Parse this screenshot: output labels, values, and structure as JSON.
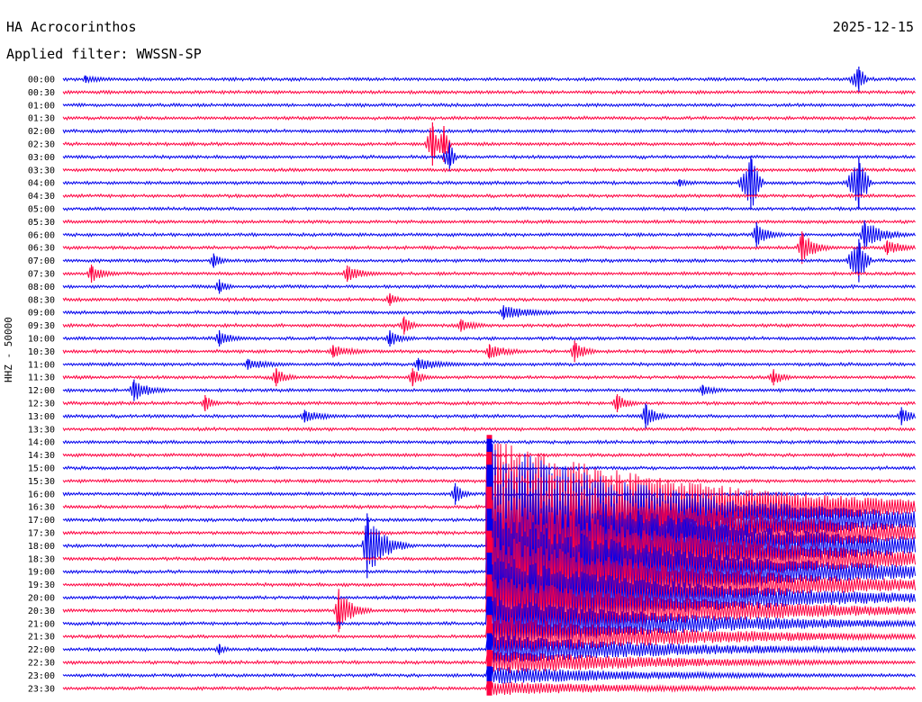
{
  "header": {
    "station": "HA Acrocorinthos",
    "date": "2025-12-15",
    "filter": "Applied filter: WWSSN-SP"
  },
  "axis_label": "HHZ - 50000",
  "colors": {
    "even": "#0000ee",
    "odd": "#ff0040"
  },
  "chart_data": {
    "type": "line",
    "title": "HA Acrocorinthos 2025-12-15",
    "channel": "HHZ",
    "scale": 50000,
    "filter": "WWSSN-SP",
    "minutes_per_line": 30,
    "row_labels": [
      "00:00",
      "00:30",
      "01:00",
      "01:30",
      "02:00",
      "02:30",
      "03:00",
      "03:30",
      "04:00",
      "04:30",
      "05:00",
      "05:30",
      "06:00",
      "06:30",
      "07:00",
      "07:30",
      "08:00",
      "08:30",
      "09:00",
      "09:30",
      "10:00",
      "10:30",
      "11:00",
      "11:30",
      "12:00",
      "12:30",
      "13:00",
      "13:30",
      "14:00",
      "14:30",
      "15:00",
      "15:30",
      "16:00",
      "16:30",
      "17:00",
      "17:30",
      "18:00",
      "18:30",
      "19:00",
      "19:30",
      "20:00",
      "20:30",
      "21:00",
      "21:30",
      "22:00",
      "22:30",
      "23:00",
      "23:30"
    ],
    "noise_level": [
      2,
      2,
      2,
      2,
      2,
      2,
      2,
      2,
      2,
      2,
      2,
      2,
      2,
      2,
      2,
      2,
      2,
      2,
      2,
      2,
      2,
      2,
      2,
      2,
      2,
      2,
      2,
      2,
      2,
      2,
      2,
      2,
      2,
      2,
      2,
      2,
      2,
      2,
      2,
      2,
      2,
      2,
      2,
      2,
      2,
      2,
      2,
      2
    ],
    "events": [
      {
        "row": 0,
        "minute": 0.8,
        "amp": 4,
        "dur": 2.5,
        "kind": "wave"
      },
      {
        "row": 0,
        "minute": 28.0,
        "amp": 14,
        "dur": 0.4,
        "kind": "spike"
      },
      {
        "row": 5,
        "minute": 13.0,
        "amp": 24,
        "dur": 0.3,
        "kind": "spike"
      },
      {
        "row": 5,
        "minute": 13.4,
        "amp": 20,
        "dur": 0.3,
        "kind": "spike"
      },
      {
        "row": 6,
        "minute": 13.6,
        "amp": 16,
        "dur": 0.3,
        "kind": "spike"
      },
      {
        "row": 8,
        "minute": 21.7,
        "amp": 4,
        "dur": 1.5,
        "kind": "wave"
      },
      {
        "row": 8,
        "minute": 24.2,
        "amp": 30,
        "dur": 0.5,
        "kind": "spike"
      },
      {
        "row": 8,
        "minute": 28.0,
        "amp": 28,
        "dur": 0.5,
        "kind": "spike"
      },
      {
        "row": 12,
        "minute": 24.4,
        "amp": 14,
        "dur": 1.2,
        "kind": "wave"
      },
      {
        "row": 12,
        "minute": 28.2,
        "amp": 16,
        "dur": 1.8,
        "kind": "wave"
      },
      {
        "row": 13,
        "minute": 26.0,
        "amp": 18,
        "dur": 1.2,
        "kind": "wave"
      },
      {
        "row": 13,
        "minute": 29.0,
        "amp": 8,
        "dur": 2.0,
        "kind": "wave"
      },
      {
        "row": 14,
        "minute": 5.3,
        "amp": 8,
        "dur": 0.8,
        "kind": "wave"
      },
      {
        "row": 14,
        "minute": 28.0,
        "amp": 24,
        "dur": 0.5,
        "kind": "spike"
      },
      {
        "row": 15,
        "minute": 1.0,
        "amp": 10,
        "dur": 1.3,
        "kind": "wave"
      },
      {
        "row": 15,
        "minute": 10.0,
        "amp": 9,
        "dur": 1.5,
        "kind": "wave"
      },
      {
        "row": 16,
        "minute": 5.5,
        "amp": 8,
        "dur": 0.8,
        "kind": "wave"
      },
      {
        "row": 17,
        "minute": 11.5,
        "amp": 7,
        "dur": 0.8,
        "kind": "wave"
      },
      {
        "row": 18,
        "minute": 15.5,
        "amp": 8,
        "dur": 3.0,
        "kind": "wave"
      },
      {
        "row": 19,
        "minute": 12.0,
        "amp": 10,
        "dur": 0.8,
        "kind": "wave"
      },
      {
        "row": 19,
        "minute": 14.0,
        "amp": 7,
        "dur": 1.5,
        "kind": "wave"
      },
      {
        "row": 20,
        "minute": 5.5,
        "amp": 9,
        "dur": 1.2,
        "kind": "wave"
      },
      {
        "row": 20,
        "minute": 11.5,
        "amp": 9,
        "dur": 1.2,
        "kind": "wave"
      },
      {
        "row": 21,
        "minute": 9.5,
        "amp": 7,
        "dur": 2.0,
        "kind": "wave"
      },
      {
        "row": 21,
        "minute": 15.0,
        "amp": 8,
        "dur": 2.0,
        "kind": "wave"
      },
      {
        "row": 21,
        "minute": 18.0,
        "amp": 12,
        "dur": 1.0,
        "kind": "wave"
      },
      {
        "row": 22,
        "minute": 6.5,
        "amp": 6,
        "dur": 2.5,
        "kind": "wave"
      },
      {
        "row": 22,
        "minute": 12.5,
        "amp": 7,
        "dur": 2.5,
        "kind": "wave"
      },
      {
        "row": 23,
        "minute": 7.5,
        "amp": 10,
        "dur": 1.0,
        "kind": "wave"
      },
      {
        "row": 23,
        "minute": 12.3,
        "amp": 10,
        "dur": 1.0,
        "kind": "wave"
      },
      {
        "row": 23,
        "minute": 25.0,
        "amp": 9,
        "dur": 1.0,
        "kind": "wave"
      },
      {
        "row": 24,
        "minute": 2.5,
        "amp": 12,
        "dur": 1.5,
        "kind": "wave"
      },
      {
        "row": 24,
        "minute": 22.5,
        "amp": 6,
        "dur": 1.5,
        "kind": "wave"
      },
      {
        "row": 25,
        "minute": 5.0,
        "amp": 9,
        "dur": 0.8,
        "kind": "wave"
      },
      {
        "row": 25,
        "minute": 19.5,
        "amp": 10,
        "dur": 1.0,
        "kind": "wave"
      },
      {
        "row": 26,
        "minute": 8.5,
        "amp": 7,
        "dur": 2.0,
        "kind": "wave"
      },
      {
        "row": 26,
        "minute": 20.5,
        "amp": 14,
        "dur": 1.0,
        "kind": "wave"
      },
      {
        "row": 26,
        "minute": 29.5,
        "amp": 10,
        "dur": 1.0,
        "kind": "wave"
      },
      {
        "row": 32,
        "minute": 13.8,
        "amp": 12,
        "dur": 0.8,
        "kind": "wave"
      },
      {
        "row": 33,
        "minute": 15.0,
        "amp": 80,
        "dur": 30.0,
        "kind": "quake"
      },
      {
        "row": 34,
        "minute": 15.0,
        "amp": 90,
        "dur": 30.0,
        "kind": "quake"
      },
      {
        "row": 35,
        "minute": 15.0,
        "amp": 90,
        "dur": 30.0,
        "kind": "quake"
      },
      {
        "row": 36,
        "minute": 10.7,
        "amp": 36,
        "dur": 1.5,
        "kind": "wave"
      },
      {
        "row": 36,
        "minute": 15.0,
        "amp": 90,
        "dur": 30.0,
        "kind": "quake"
      },
      {
        "row": 37,
        "minute": 15.0,
        "amp": 80,
        "dur": 30.0,
        "kind": "quake"
      },
      {
        "row": 38,
        "minute": 15.0,
        "amp": 70,
        "dur": 30.0,
        "kind": "quake"
      },
      {
        "row": 39,
        "minute": 15.0,
        "amp": 60,
        "dur": 30.0,
        "kind": "quake"
      },
      {
        "row": 40,
        "minute": 15.0,
        "amp": 50,
        "dur": 30.0,
        "kind": "quake"
      },
      {
        "row": 41,
        "minute": 9.7,
        "amp": 24,
        "dur": 1.2,
        "kind": "wave"
      },
      {
        "row": 41,
        "minute": 15.0,
        "amp": 40,
        "dur": 30.0,
        "kind": "quake"
      },
      {
        "row": 42,
        "minute": 15.0,
        "amp": 30,
        "dur": 30.0,
        "kind": "quake"
      },
      {
        "row": 43,
        "minute": 15.0,
        "amp": 24,
        "dur": 30.0,
        "kind": "quake"
      },
      {
        "row": 44,
        "minute": 5.5,
        "amp": 6,
        "dur": 0.8,
        "kind": "wave"
      },
      {
        "row": 44,
        "minute": 15.0,
        "amp": 18,
        "dur": 30.0,
        "kind": "quake"
      },
      {
        "row": 45,
        "minute": 15.0,
        "amp": 14,
        "dur": 30.0,
        "kind": "quake"
      },
      {
        "row": 46,
        "minute": 15.0,
        "amp": 10,
        "dur": 30.0,
        "kind": "quake"
      },
      {
        "row": 47,
        "minute": 15.0,
        "amp": 8,
        "dur": 30.0,
        "kind": "quake"
      }
    ]
  }
}
